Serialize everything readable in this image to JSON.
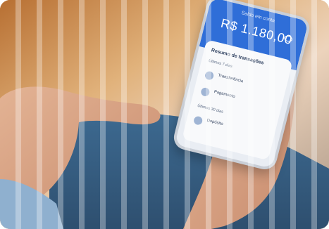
{
  "image": {
    "description_alt": "Hand pointing at a smartphone showing a banking app balance screen",
    "colors": {
      "accent": "#2f6ed8",
      "skin": "#d9a07f",
      "denim": "#3a5f82",
      "bg": "#d8a060"
    }
  },
  "phone": {
    "small_label": "Saldo em conta",
    "balance": "R$ 1.180,00",
    "section_title": "Resumo de transações",
    "group_1": "Últimos 7 dias",
    "group_2": "Últimos 30 dias",
    "rows": [
      {
        "left": "Transferência",
        "right": ""
      },
      {
        "left": "Pagamento",
        "right": ""
      },
      {
        "left": "Depósito",
        "right": ""
      }
    ]
  }
}
